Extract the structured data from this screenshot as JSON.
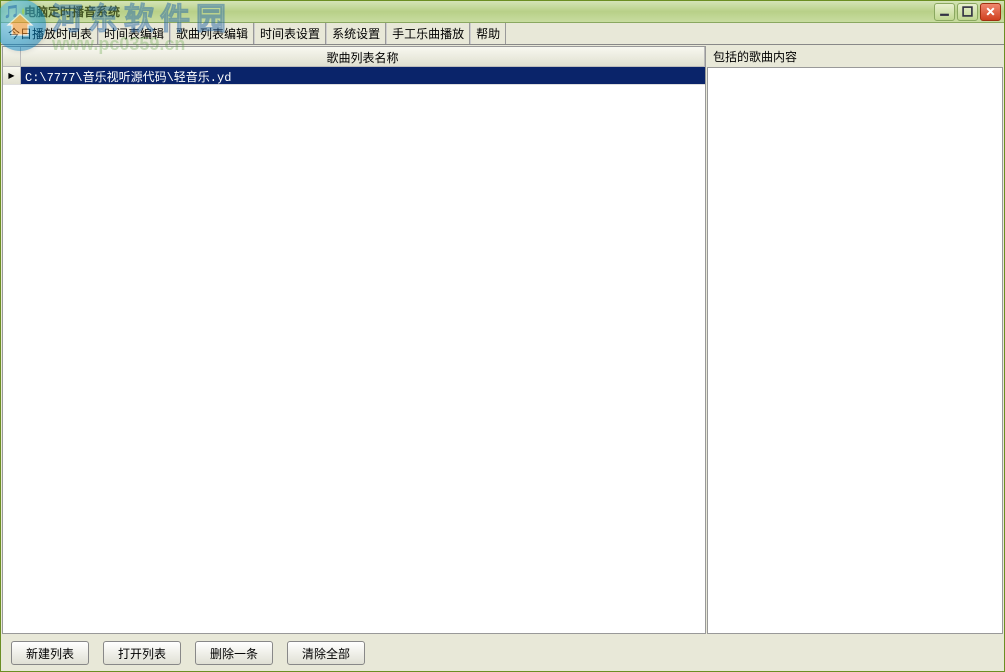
{
  "window": {
    "title": "电脑定时播音系统"
  },
  "menu": {
    "items": [
      "今日播放时间表",
      "时间表编辑",
      "歌曲列表编辑",
      "时间表设置",
      "系统设置",
      "手工乐曲播放",
      "帮助"
    ]
  },
  "grid": {
    "column_header": "歌曲列表名称",
    "rows": [
      {
        "path": "C:\\7777\\音乐视听源代码\\轻音乐.yd"
      }
    ]
  },
  "right_panel": {
    "label": "包括的歌曲内容"
  },
  "buttons": {
    "new_list": "新建列表",
    "open_list": "打开列表",
    "delete_one": "删除一条",
    "clear_all": "清除全部"
  },
  "watermark": {
    "cn": "河东软件园",
    "url": "www.pc0359.cn"
  }
}
